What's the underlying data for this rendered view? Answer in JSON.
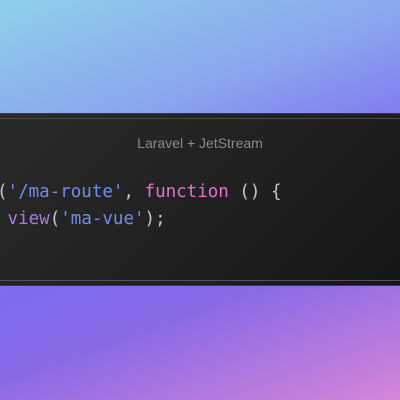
{
  "window": {
    "title": "Laravel + JetStream"
  },
  "code": {
    "line1": {
      "open": "(",
      "string": "'/ma-route'",
      "comma": ", ",
      "keyword": "function",
      "rest": " () {"
    },
    "line2": {
      "indent": " ",
      "func": "view",
      "open": "(",
      "string": "'ma-vue'",
      "close": ");"
    }
  },
  "colors": {
    "string": "#6f8df0",
    "keyword": "#e86fd0",
    "function": "#a67be8"
  }
}
